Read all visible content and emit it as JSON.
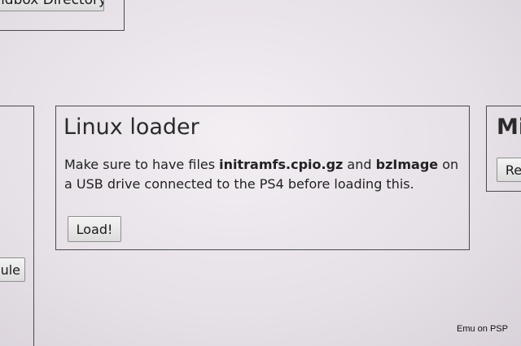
{
  "sandbox_card": {
    "button_label": "ndbox Directory"
  },
  "left_card": {
    "button_label": "ule"
  },
  "linux_loader": {
    "title": "Linux loader",
    "desc_part1": "Make sure to have files ",
    "file1": "initramfs.cpio.gz",
    "desc_part2": " and ",
    "file2": "bzImage",
    "desc_part3": " on a USB drive connected to the PS4 before loading this.",
    "load_label": "Load!"
  },
  "right_card": {
    "title": "Mi",
    "button_label": "Re"
  },
  "watermark": "Emu on PSP"
}
